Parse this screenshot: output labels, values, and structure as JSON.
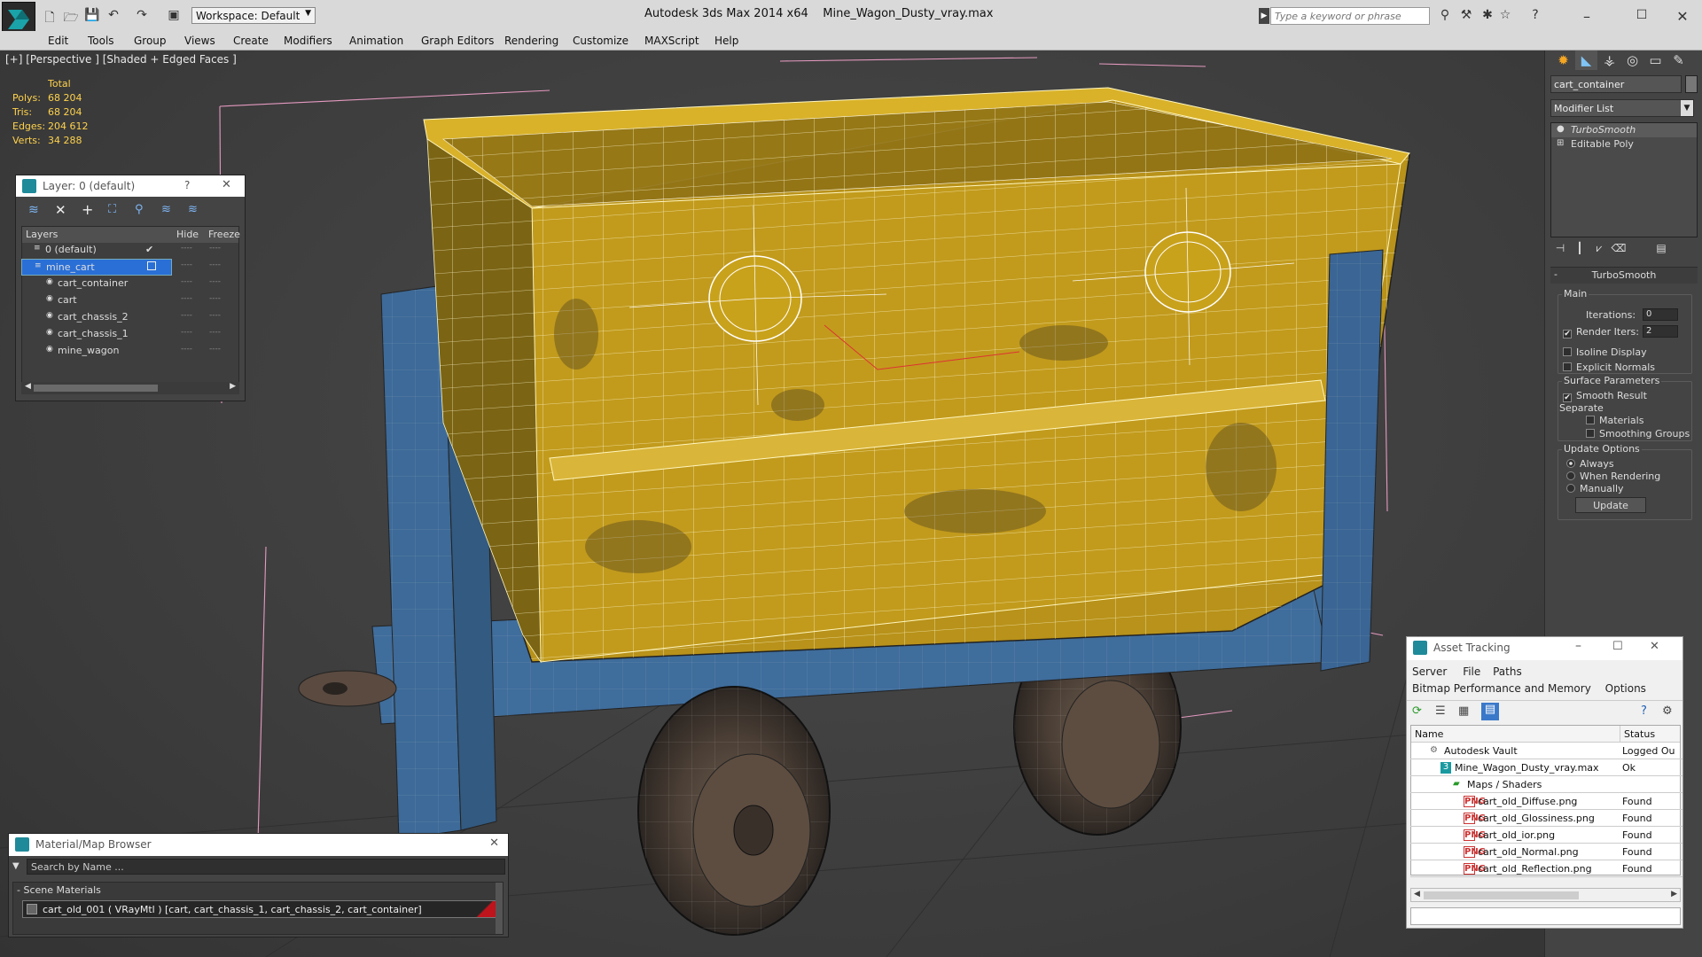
{
  "title_bar": {
    "app_title": "Autodesk 3ds Max  2014 x64",
    "file_name": "Mine_Wagon_Dusty_vray.max",
    "workspace": "Workspace: Default",
    "search_placeholder": "Type a keyword or phrase"
  },
  "menu": [
    "Edit",
    "Tools",
    "Group",
    "Views",
    "Create",
    "Modifiers",
    "Animation",
    "Graph Editors",
    "Rendering",
    "Customize",
    "MAXScript",
    "Help"
  ],
  "viewport": {
    "label": "[+] [Perspective ] [Shaded + Edged Faces ]",
    "stats": {
      "header": "Total",
      "rows": [
        {
          "key": "Polys:",
          "value": "68 204"
        },
        {
          "key": "Tris:",
          "value": "68 204"
        },
        {
          "key": "Edges:",
          "value": "204 612"
        },
        {
          "key": "Verts:",
          "value": "34 288"
        }
      ]
    }
  },
  "layer_panel": {
    "title": "Layer: 0 (default)",
    "help": "?",
    "columns": {
      "layers": "Layers",
      "hide": "Hide",
      "freeze": "Freeze"
    },
    "rows": [
      {
        "name": "0 (default)",
        "indent": 1,
        "selected": false,
        "active": true
      },
      {
        "name": "mine_cart",
        "indent": 1,
        "selected": true,
        "active": false
      },
      {
        "name": "cart_container",
        "indent": 2,
        "selected": false,
        "active": false
      },
      {
        "name": "cart",
        "indent": 2,
        "selected": false,
        "active": false
      },
      {
        "name": "cart_chassis_2",
        "indent": 2,
        "selected": false,
        "active": false
      },
      {
        "name": "cart_chassis_1",
        "indent": 2,
        "selected": false,
        "active": false
      },
      {
        "name": "mine_wagon",
        "indent": 2,
        "selected": false,
        "active": false
      }
    ]
  },
  "command_panel": {
    "object_name": "cart_container",
    "modifier_list": "Modifier List",
    "stack": [
      "TurboSmooth",
      "Editable Poly"
    ],
    "turbosmooth": {
      "title": "TurboSmooth",
      "main_label": "Main",
      "iterations_label": "Iterations:",
      "iterations_value": "0",
      "render_iters_label": "Render Iters:",
      "render_iters_value": "2",
      "render_iters_checked": true,
      "isoline_display": "Isoline Display",
      "explicit_normals": "Explicit Normals",
      "surface_parameters": "Surface Parameters",
      "smooth_result": "Smooth Result",
      "separate": "Separate",
      "materials": "Materials",
      "smoothing_groups": "Smoothing Groups",
      "update_options": "Update Options",
      "always": "Always",
      "when_rendering": "When Rendering",
      "manually": "Manually",
      "update_button": "Update"
    }
  },
  "material_browser": {
    "title": "Material/Map Browser",
    "search_placeholder": "Search by Name ...",
    "section": "- Scene Materials",
    "material_entry": "cart_old_001  ( VRayMtl )  [cart, cart_chassis_1, cart_chassis_2, cart_container]"
  },
  "asset_tracking": {
    "title": "Asset Tracking",
    "menu_row1": [
      "Server",
      "File",
      "Paths"
    ],
    "menu_row2": [
      "Bitmap Performance and Memory",
      "Options"
    ],
    "columns": {
      "name": "Name",
      "status": "Status"
    },
    "rows": [
      {
        "name": "Autodesk Vault",
        "status": "Logged Ou",
        "indent": 22,
        "icon": "vault"
      },
      {
        "name": "Mine_Wagon_Dusty_vray.max",
        "status": "Ok",
        "indent": 34,
        "icon": "max"
      },
      {
        "name": "Maps / Shaders",
        "status": "",
        "indent": 48,
        "icon": "maps"
      },
      {
        "name": "cart_old_Diffuse.png",
        "status": "Found",
        "indent": 60,
        "icon": "png"
      },
      {
        "name": "cart_old_Glossiness.png",
        "status": "Found",
        "indent": 60,
        "icon": "png"
      },
      {
        "name": "cart_old_ior.png",
        "status": "Found",
        "indent": 60,
        "icon": "png"
      },
      {
        "name": "cart_old_Normal.png",
        "status": "Found",
        "indent": 60,
        "icon": "png"
      },
      {
        "name": "cart_old_Reflection.png",
        "status": "Found",
        "indent": 60,
        "icon": "png"
      }
    ]
  },
  "colors": {
    "cart_yellow": "#c9a21c",
    "frame_blue": "#3f6e9e",
    "selection_blue": "#2a6fd6",
    "stats_yellow": "#ffd24d"
  }
}
